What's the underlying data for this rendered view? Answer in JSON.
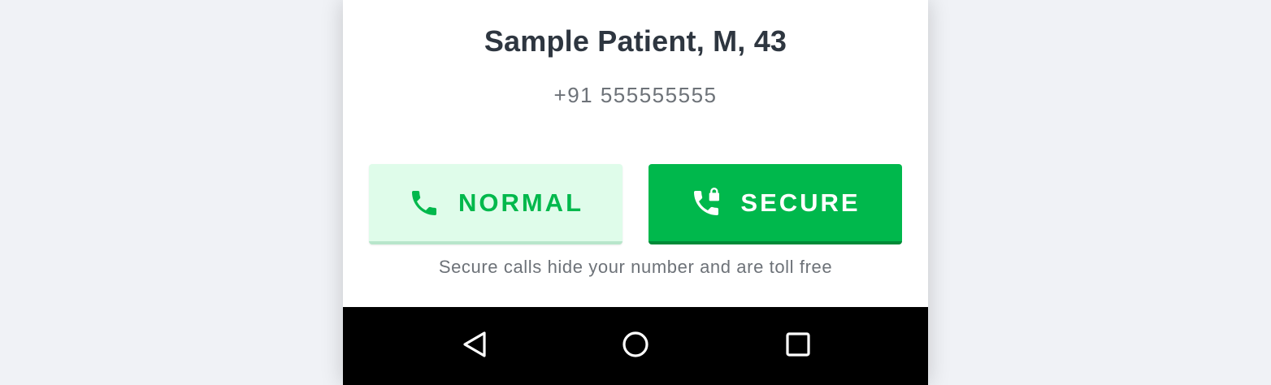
{
  "patient": {
    "name": "Sample Patient, M, 43",
    "phone": "+91 555555555"
  },
  "actions": {
    "normal_label": "NORMAL",
    "normal_icon": "phone-icon",
    "secure_label": "SECURE",
    "secure_icon": "phone-lock-icon",
    "hint": "Secure calls hide your number and are toll free"
  },
  "navbar": {
    "back_icon": "back-triangle-icon",
    "home_icon": "home-circle-icon",
    "recents_icon": "recents-square-icon"
  },
  "colors": {
    "accent_green": "#00b84c",
    "light_green": "#dffcea",
    "text_dark": "#2e3640",
    "text_muted": "#6d7278",
    "background": "#f0f2f6"
  }
}
